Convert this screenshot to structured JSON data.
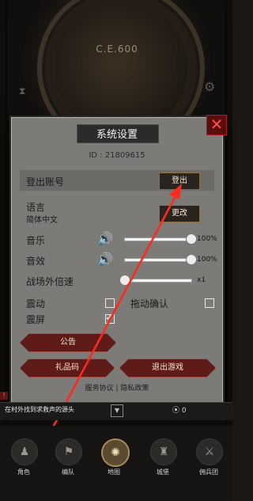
{
  "background": {
    "year_label": "C.E.600",
    "hourglass_icon": "hourglass-icon",
    "gear_icon": "gear-icon"
  },
  "settings": {
    "title": "系统设置",
    "id_text": "ID : 21809615",
    "account": {
      "label": "登出账号",
      "button": "登出"
    },
    "language": {
      "label": "语言",
      "value": "简体中文",
      "button": "更改"
    },
    "music": {
      "label": "音乐",
      "level": 1.0,
      "value_text": "100%"
    },
    "sfx": {
      "label": "音效",
      "level": 1.0,
      "value_text": "100%"
    },
    "battle_speed": {
      "label": "战场外倍速",
      "level": 0.0,
      "value_text": "x1"
    },
    "vibration": {
      "label": "震动",
      "checked": false
    },
    "drag_confirm": {
      "label": "拖动确认",
      "checked": false
    },
    "screen_shake": {
      "label": "震屏",
      "checked": true
    },
    "announcement_button": "公告",
    "gift_code_button": "礼品码",
    "exit_game_button": "退出游戏",
    "service_agreement_link": "服务协议",
    "separator": "|",
    "privacy_policy_link": "隐私政策"
  },
  "status_strip": {
    "quest_text": "在村外找到求救声的源头",
    "coin_count": "0"
  },
  "bottom_nav": [
    {
      "label": "角色",
      "icon": "character-icon",
      "active": false
    },
    {
      "label": "编队",
      "icon": "formation-icon",
      "active": false
    },
    {
      "label": "地图",
      "icon": "map-icon",
      "active": true
    },
    {
      "label": "城堡",
      "icon": "castle-icon",
      "active": false
    },
    {
      "label": "佣兵团",
      "icon": "mercenary-icon",
      "active": false
    }
  ],
  "colors": {
    "arrow": "#ff2a1f",
    "close_icon": "#ff4b4b"
  }
}
